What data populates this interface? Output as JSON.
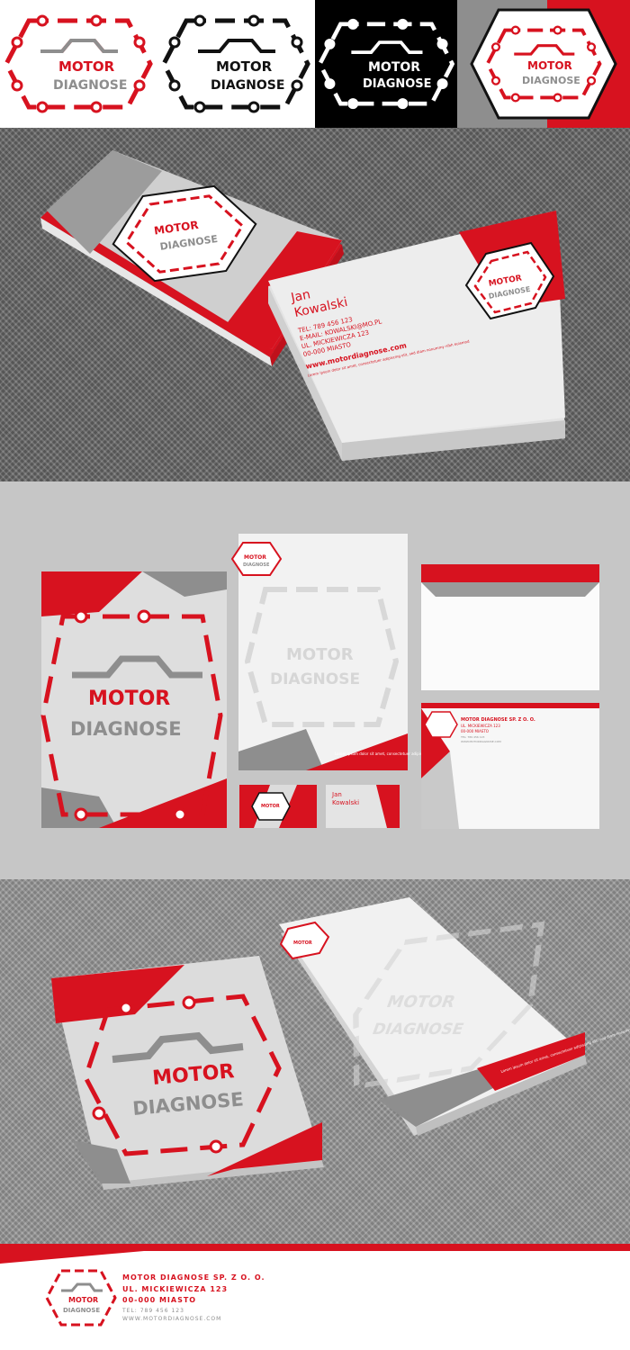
{
  "brand": {
    "logo_word_1": "MOTOR",
    "logo_word_2": "DIAGNOSE",
    "colors": {
      "red": "#d7121f",
      "gray": "#8e8e8e",
      "light_gray": "#d9d9d9",
      "black": "#000000",
      "white": "#ffffff"
    }
  },
  "business_card": {
    "first_name": "Jan",
    "last_name": "Kowalski",
    "phone": "TEL: 789 456 123",
    "email": "E-MAIL: KOWALSKI@MO.PL",
    "street": "UL. MICKIEWICZA 123",
    "city": "00-000 MIASTO",
    "website": "www.motordiagnose.com",
    "lorem": "Lorem ipsum dolor sit amet, consectetuer adipiscing elit, sed diam nonummy nibh euismod"
  },
  "letterhead": {
    "lorem": "Lorem ipsum dolor sit amet, consectetuer adipiscing elit, sed diam nonummy nibh euis"
  },
  "envelope": {
    "company": "MOTOR DIAGNOSE SP. Z O. O.",
    "street": "UL. MICKIEWICZA 123",
    "city": "00-000 MIASTO",
    "phone": "TEL: 789 456 123",
    "web": "WWW.MOTORDIAGNOSE.COM"
  },
  "footer": {
    "company": "MOTOR DIAGNOSE SP. Z O. O.",
    "street": "UL. MICKIEWICZA 123",
    "city": "00-000 MIASTO",
    "phone": "TEL: 789 456 123",
    "web": "WWW.MOTORDIAGNOSE.COM"
  }
}
